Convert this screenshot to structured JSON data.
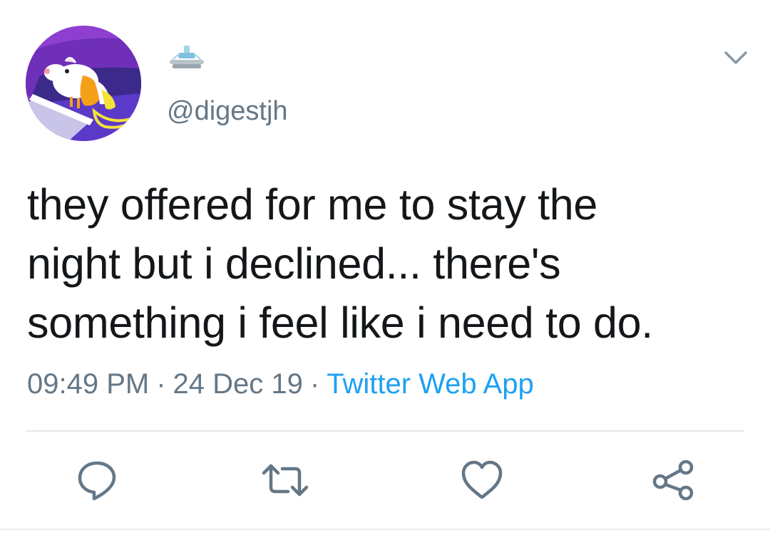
{
  "user": {
    "handle": "@digestjh",
    "display_name_icon": "fountain-emoji-icon",
    "avatar": "cartoon-mouse-avatar"
  },
  "tweet": {
    "lines": [
      "they offered for me to stay the",
      "night but i declined... there's",
      "something i feel like i need to do."
    ]
  },
  "meta": {
    "time": "09:49 PM",
    "separator": "·",
    "date": "24 Dec 19",
    "source": "Twitter Web App"
  },
  "actions": {
    "reply_icon": "reply-icon",
    "retweet_icon": "retweet-icon",
    "like_icon": "heart-icon",
    "share_icon": "share-icon"
  },
  "colors": {
    "text": "#14171a",
    "secondary": "#657786",
    "link": "#1da1f2",
    "icon": "#657786"
  }
}
